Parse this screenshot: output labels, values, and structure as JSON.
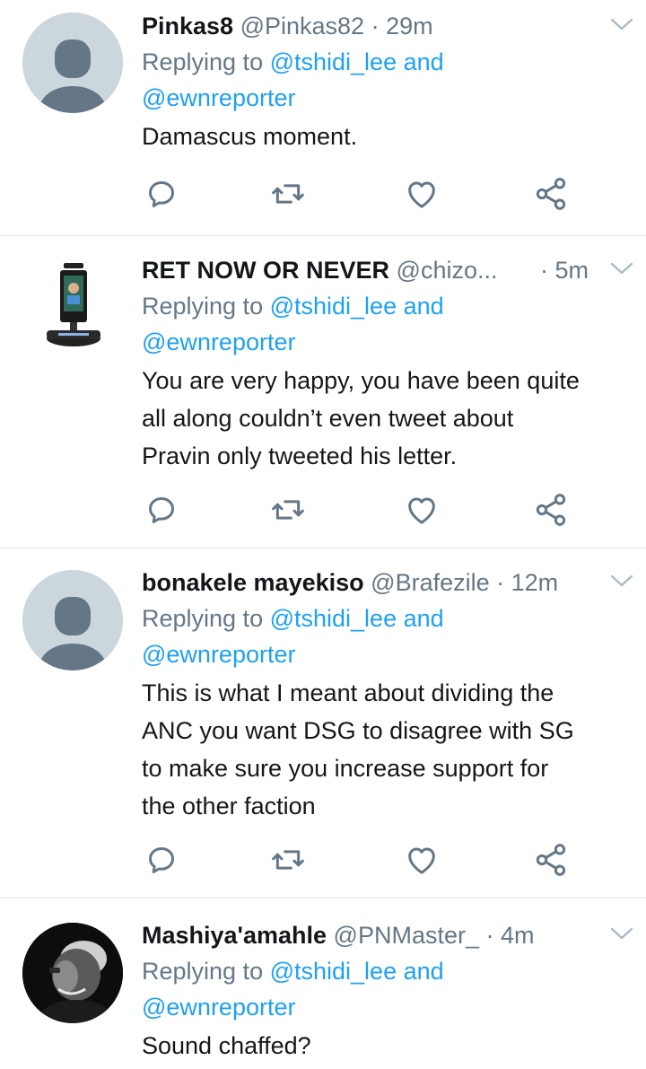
{
  "tweets": [
    {
      "name": "Pinkas8",
      "handle": "@Pinkas82",
      "sep": " · ",
      "time": "29m",
      "reply_prefix": "Replying to ",
      "mention1": "@tshidi_lee",
      "and_word": " and",
      "mention2": "@ewnreporter",
      "lines": [
        "Damascus moment."
      ],
      "avatar": "default-avatar"
    },
    {
      "name": "RET NOW OR NEVER",
      "handle": "@chizo...",
      "sep": " · ",
      "time": "5m",
      "reply_prefix": "Replying to ",
      "mention1": "@tshidi_lee",
      "and_word": " and",
      "mention2": "@ewnreporter",
      "lines": [
        "You are very happy, you have been quite",
        "all along couldn’t even tweet about",
        "Pravin only tweeted his letter."
      ],
      "avatar": "kiosk-device-avatar"
    },
    {
      "name": "bonakele mayekiso",
      "handle": "@Brafezile",
      "sep": " · ",
      "time": "12m",
      "reply_prefix": "Replying to ",
      "mention1": "@tshidi_lee",
      "and_word": " and",
      "mention2": "@ewnreporter",
      "lines": [
        "This is what I meant about dividing the",
        "ANC you want DSG to disagree with SG",
        "to make sure you increase support for",
        "the other faction"
      ],
      "avatar": "default-avatar"
    },
    {
      "name": "Mashiya'amahle",
      "handle": "@PNMaster_",
      "sep": " · ",
      "time": "4m",
      "reply_prefix": "Replying to ",
      "mention1": "@tshidi_lee",
      "and_word": " and",
      "mention2": "@ewnreporter",
      "lines": [
        "Sound chaffed?"
      ],
      "avatar": "man-photo-avatar"
    }
  ],
  "icons": {
    "reply": "reply-icon",
    "retweet": "retweet-icon",
    "like": "like-icon",
    "share": "share-icon",
    "menu": "chevron-down-icon"
  },
  "colors": {
    "text": "#14171a",
    "secondary": "#657786",
    "link": "#1da1f2",
    "divider": "#e1e8ed",
    "avatar_default": "#ccd6dd"
  }
}
